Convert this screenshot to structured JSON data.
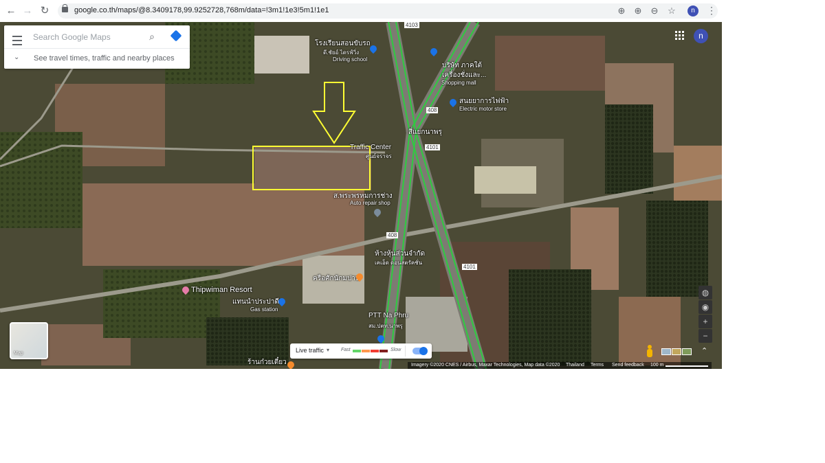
{
  "browser": {
    "url": "google.co.th/maps/@8.3409178,99.9252728,768m/data=!3m1!1e3!5m1!1e1",
    "profile_initial": "n",
    "nav_icons": [
      "back-arrow-icon",
      "forward-arrow-icon",
      "reload-icon",
      "lock-icon"
    ],
    "omnibox_icons": [
      "location-target-icon",
      "zoom-in-icon",
      "zoom-out-icon",
      "bookmark-star-icon"
    ]
  },
  "search": {
    "placeholder": "Search Google Maps",
    "travel_hint": "See travel times, traffic and nearby places"
  },
  "map": {
    "mode": "satellite",
    "avatar_initial": "n",
    "colors": {
      "traffic_fast": "#2ecc40",
      "highlight_box": "#ffff33",
      "annotation_arrow": "#ffff33"
    },
    "labels": {
      "driving_school_th": "โรงเรียนสอนขับรถ",
      "driving_school_th2": "ดี.ชัยอ์ ไดรฟ์วิ่ง",
      "driving_school_en": "Driving school",
      "company_th": "บริษัท ภาคใต้",
      "company_th2": "เครื่องชั่งและ...",
      "shopping_mall_en": "Shopping mall",
      "electric_th": "สนยยาการไฟฟ้า",
      "electric_en": "Electric motor store",
      "intersection_th": "สี่แยกนาพรุ",
      "traffic_center_en": "Traffic Center",
      "traffic_center_th": "ศูนย์จราจร",
      "repair_th": "ส.พระพรหมการช่าง",
      "repair_en": "Auto repair shop",
      "partnership_th": "ห้างหุ้นส่วนจำกัด",
      "partnership_th2": "เคเอ็ด ดอนสตรัคชั่น",
      "food_th": "ครือศักนักมปาน",
      "resort_en": "Thipwiman Resort",
      "gas_th": "แทนนำประปาดี",
      "gas_en": "Gas station",
      "ptt_en": "PTT Na Phru",
      "ptt_th": "สม.ปตท.นาพรุ",
      "shop_th": "ร้านก๋วยเตี๋ยว",
      "road_shield_1": "4103",
      "road_shield_2": "408",
      "road_shield_3": "4101"
    },
    "thumbnail_label": "Map",
    "right_controls": [
      "globe-icon",
      "compass-icon",
      "zoom-in-icon",
      "zoom-out-icon"
    ],
    "traffic": {
      "label": "Live traffic",
      "fast": "Fast",
      "slow": "Slow",
      "bar_colors": [
        "#63d668",
        "#ff974d",
        "#f23c32",
        "#811f1f"
      ]
    },
    "attribution": {
      "imagery": "Imagery ©2020 CNES / Airbus, Maxar Technologies, Map data ©2020",
      "country": "Thailand",
      "terms": "Terms",
      "feedback": "Send feedback",
      "scale": "100 m"
    }
  }
}
